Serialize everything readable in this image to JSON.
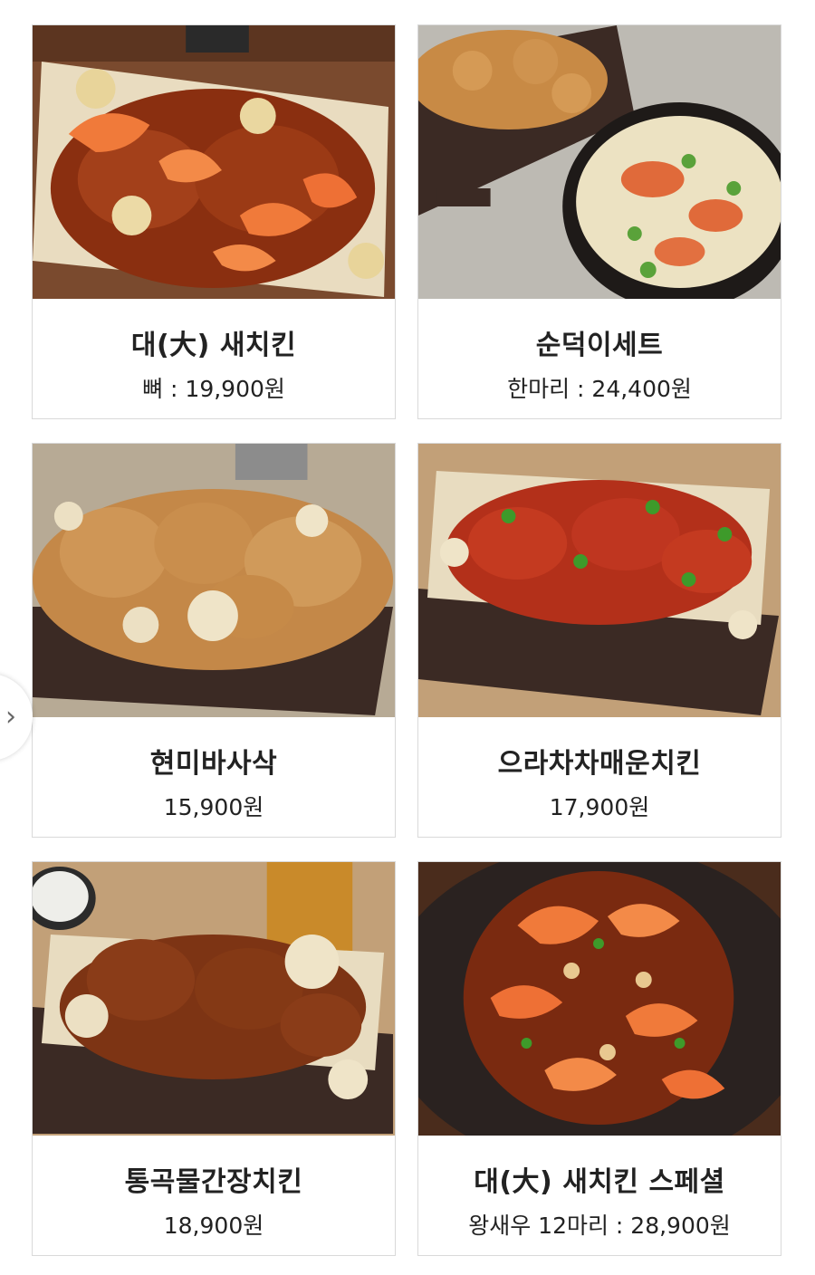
{
  "menu": {
    "items": [
      {
        "name": "대(大) 새치킨",
        "price": "뼈 : 19,900원",
        "image": "shrimp-chicken-box-photo"
      },
      {
        "name": "순덕이세트",
        "price": "한마리 : 24,400원",
        "image": "chicken-and-cheese-stew-photo"
      },
      {
        "name": "현미바사삭",
        "price": "15,900원",
        "image": "crispy-fried-chicken-box-photo"
      },
      {
        "name": "으라차차매운치킨",
        "price": "17,900원",
        "image": "spicy-chicken-box-photo"
      },
      {
        "name": "통곡물간장치킨",
        "price": "18,900원",
        "image": "soy-chicken-box-photo"
      },
      {
        "name": "대(大) 새치킨 스페셜",
        "price": "왕새우 12마리 : 28,900원",
        "image": "shrimp-chicken-plate-photo"
      }
    ]
  },
  "nav": {
    "next_icon": "chevron-right-icon",
    "glyph": "›"
  },
  "colors": {
    "border": "#d9d9d9",
    "text": "#222222",
    "box_brown": "#3b2a24"
  }
}
